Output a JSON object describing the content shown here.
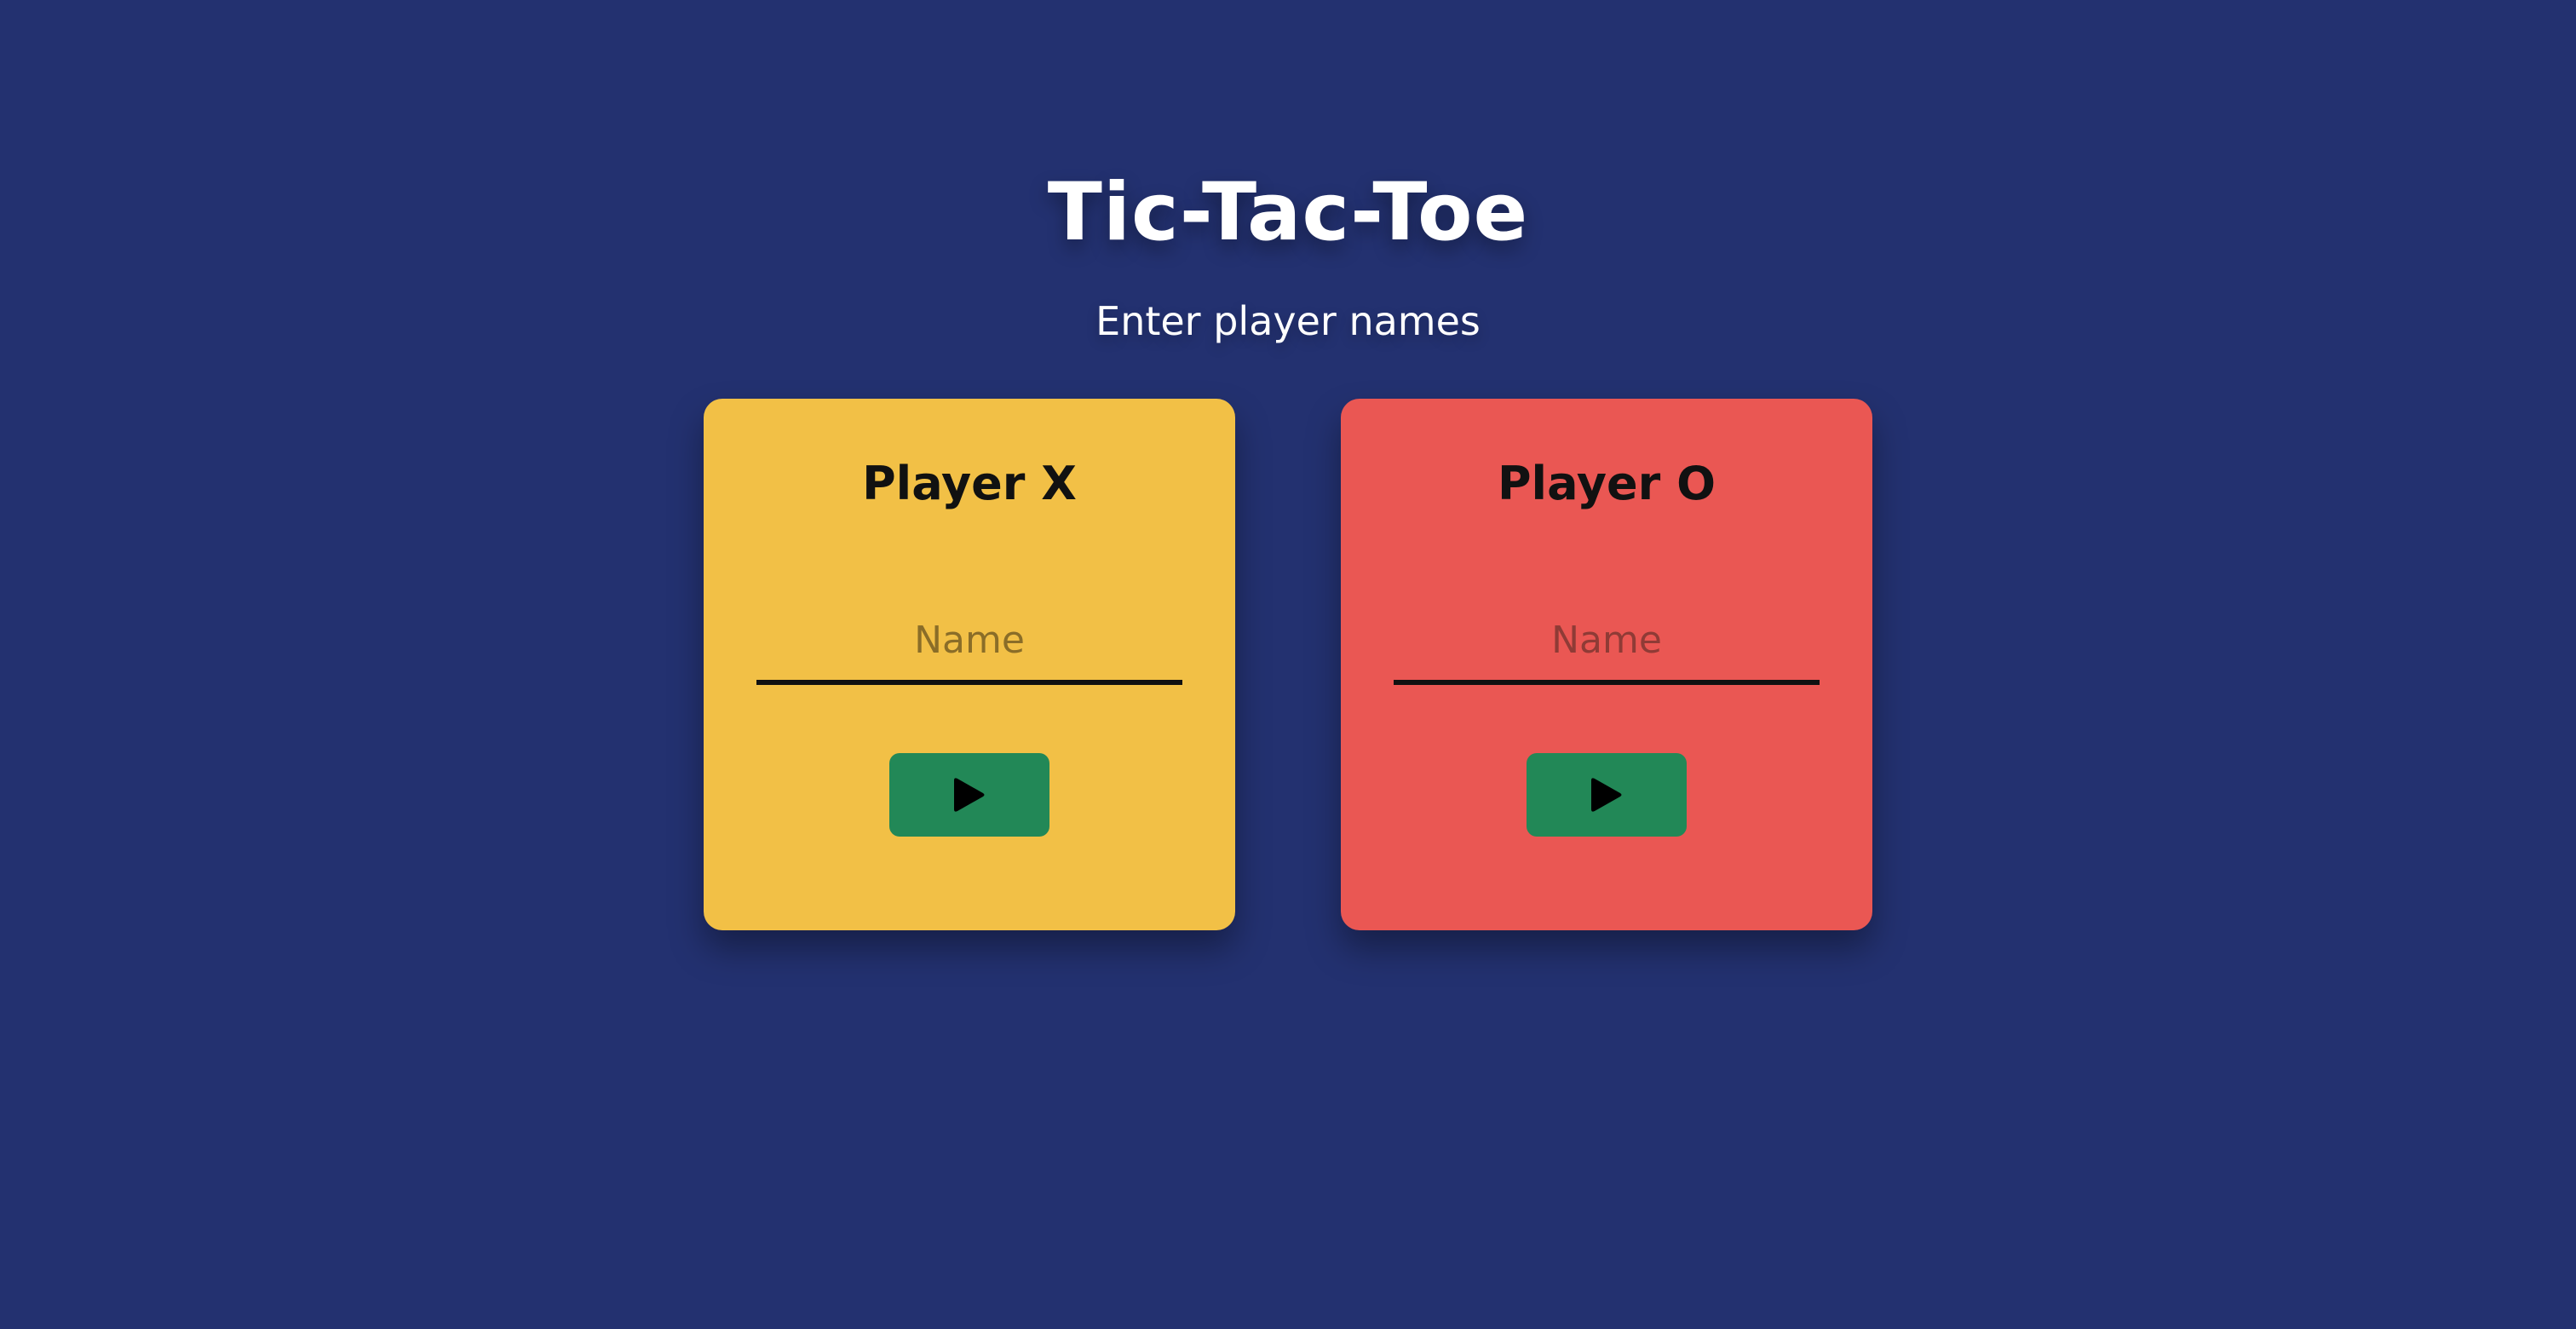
{
  "header": {
    "title": "Tic-Tac-Toe",
    "subtitle": "Enter player names"
  },
  "players": [
    {
      "label": "Player X",
      "name_value": "",
      "name_placeholder": "Name",
      "card_color": "#f2c046",
      "button_icon": "play-icon"
    },
    {
      "label": "Player O",
      "name_value": "",
      "name_placeholder": "Name",
      "card_color": "#ea5753",
      "button_icon": "play-icon"
    }
  ],
  "colors": {
    "background": "#233170",
    "play_button": "#228857",
    "text_dark": "#111111",
    "text_light": "#ffffff"
  }
}
